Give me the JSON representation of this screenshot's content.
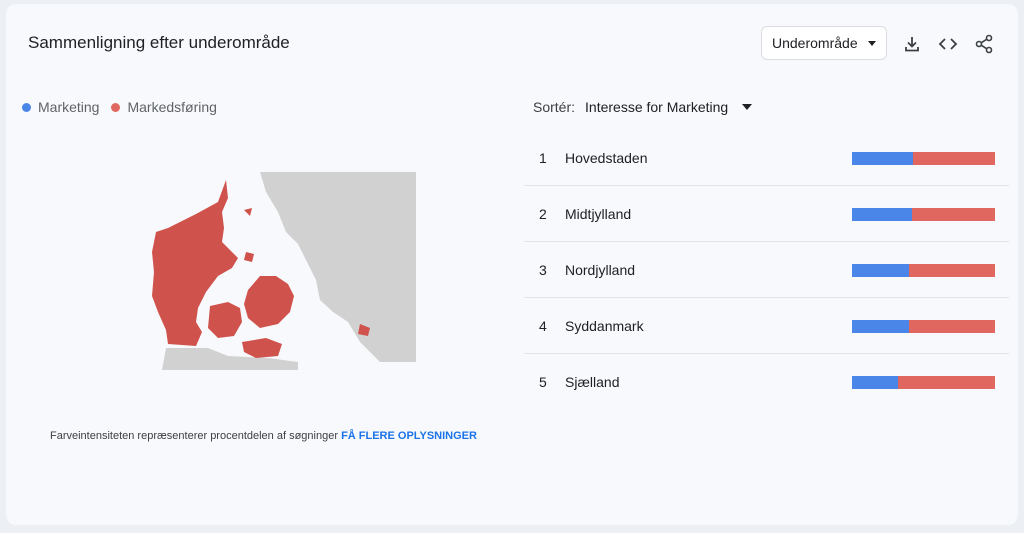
{
  "header": {
    "title": "Sammenligning efter underområde",
    "dropdown_label": "Underområde"
  },
  "icons": [
    "download-icon",
    "embed-code-icon",
    "share-icon"
  ],
  "legend": [
    {
      "label": "Marketing",
      "color": "#4a86e8"
    },
    {
      "label": "Markedsføring",
      "color": "#e06660"
    }
  ],
  "sort": {
    "label": "Sortér:",
    "value": "Interesse for Marketing"
  },
  "regions": [
    {
      "rank": "1",
      "name": "Hovedstaden",
      "marketing_share": 0.43
    },
    {
      "rank": "2",
      "name": "Midtjylland",
      "marketing_share": 0.42
    },
    {
      "rank": "3",
      "name": "Nordjylland",
      "marketing_share": 0.4
    },
    {
      "rank": "4",
      "name": "Syddanmark",
      "marketing_share": 0.4
    },
    {
      "rank": "5",
      "name": "Sjælland",
      "marketing_share": 0.32
    }
  ],
  "footnote": {
    "text": "Farveintensiteten repræsenterer procentdelen af søgninger",
    "link": "FÅ FLERE OPLYSNINGER"
  }
}
